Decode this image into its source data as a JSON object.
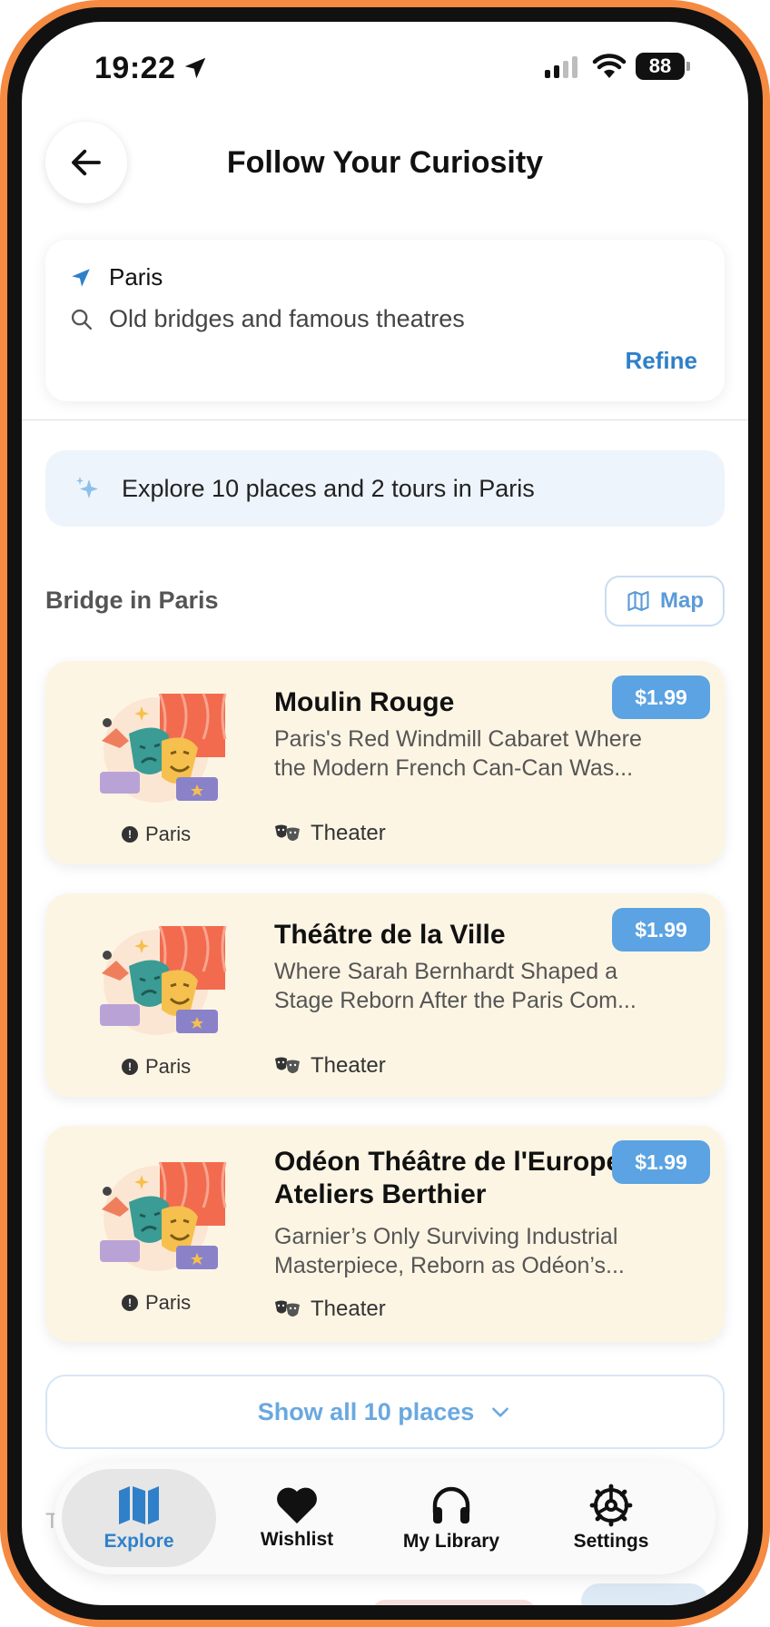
{
  "status": {
    "time": "19:22",
    "battery": "88"
  },
  "header": {
    "title": "Follow Your Curiosity"
  },
  "search": {
    "location": "Paris",
    "query": "Old bridges and famous theatres",
    "refine_label": "Refine"
  },
  "banner": {
    "text": "Explore 10 places and 2 tours in Paris"
  },
  "section": {
    "title": "Bridge in Paris",
    "map_label": "Map"
  },
  "places": [
    {
      "name": "Moulin Rouge",
      "desc_line1": "Paris's Red Windmill Cabaret Where",
      "desc_line2": "the Modern French Can-Can Was...",
      "city": "Paris",
      "category": "Theater",
      "price": "$1.99"
    },
    {
      "name": "Théâtre de la Ville",
      "desc_line1": "Where Sarah Bernhardt Shaped a",
      "desc_line2": "Stage Reborn After the Paris Com...",
      "city": "Paris",
      "category": "Theater",
      "price": "$1.99"
    },
    {
      "name_line1": "Odéon Théâtre de l'Europe",
      "name_line2": "Ateliers Berthier",
      "desc_line1": "Garnier’s Only Surviving Industrial",
      "desc_line2": "Masterpiece, Reborn as Odéon’s...",
      "city": "Paris",
      "category": "Theater",
      "price": "$1.99"
    }
  ],
  "show_all": {
    "label": "Show all 10 places"
  },
  "peek": {
    "letter": "T"
  },
  "tabs": [
    {
      "label": "Explore",
      "icon": "map-icon",
      "active": true
    },
    {
      "label": "Wishlist",
      "icon": "heart-icon",
      "active": false
    },
    {
      "label": "My Library",
      "icon": "headphones-icon",
      "active": false
    },
    {
      "label": "Settings",
      "icon": "gear-icon",
      "active": false
    }
  ],
  "colors": {
    "frame": "#f58a42",
    "accent": "#2f80c9",
    "card_bg": "#fdf5e4",
    "price_bg": "#5ba3e2",
    "banner_bg": "#edf4fc"
  }
}
